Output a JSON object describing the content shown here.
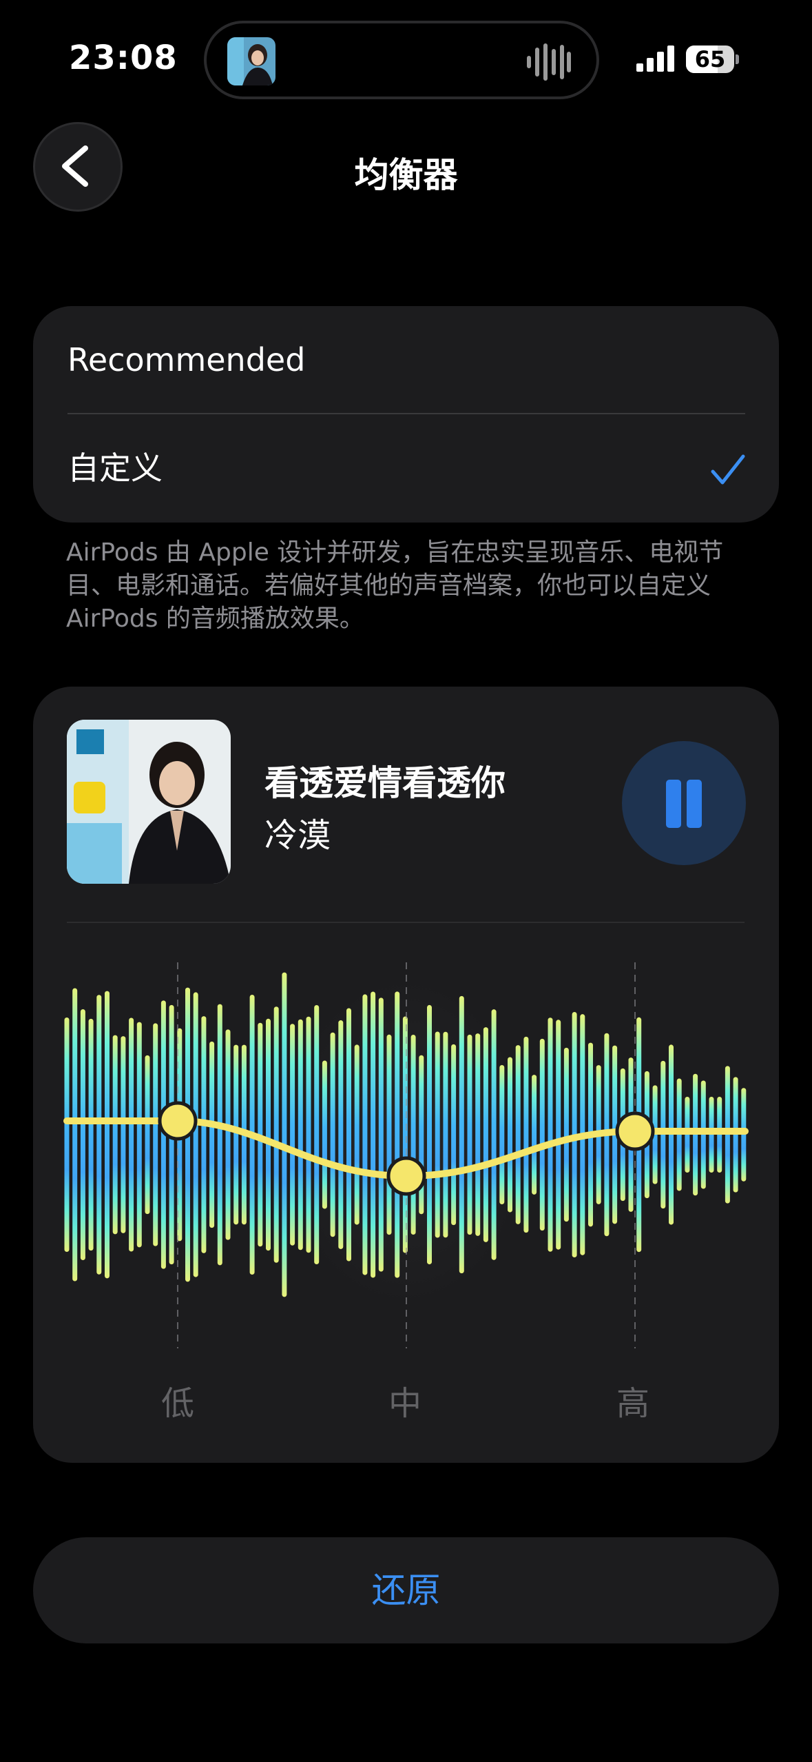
{
  "status_bar": {
    "time": "23:08",
    "battery": "65",
    "battery_level_percent": 65
  },
  "nav": {
    "title": "均衡器"
  },
  "options": [
    {
      "label": "Recommended",
      "selected": false
    },
    {
      "label": "自定义",
      "selected": true
    }
  ],
  "description": "AirPods 由 Apple 设计并研发，旨在忠实呈现音乐、电视节目、电影和通话。若偏好其他的声音档案，你也可以自定义 AirPods 的音频播放效果。",
  "player": {
    "song": "看透爱情看透你",
    "artist": "冷漠",
    "state": "playing"
  },
  "eq": {
    "bands": [
      "低",
      "中",
      "高"
    ],
    "levels": [
      0.54,
      0.38,
      0.51
    ]
  },
  "restore_label": "还原",
  "colors": {
    "accent": "#3b8ff3",
    "eq_line": "#f5e66b",
    "card": "#1c1c1e"
  }
}
